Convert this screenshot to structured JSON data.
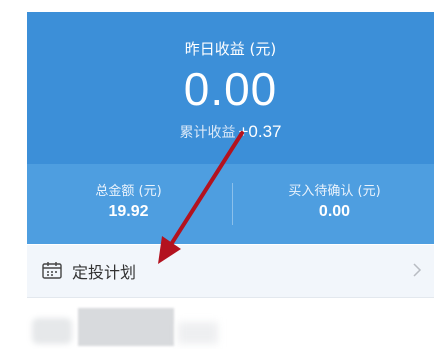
{
  "summary": {
    "yesterday_label": "昨日收益 (元)",
    "yesterday_value": "0.00",
    "cumulative_label": "累计收益",
    "cumulative_value": "+0.37"
  },
  "stats": {
    "total_label": "总金额 (元)",
    "total_value": "19.92",
    "pending_label": "买入待确认 (元)",
    "pending_value": "0.00"
  },
  "plan": {
    "label": "定投计划",
    "icon": "calendar-icon",
    "chevron": "chevron-right-icon"
  },
  "annotation": {
    "arrow_color": "#b3121f"
  },
  "colors": {
    "primary": "#3c8fd8",
    "primary_light": "#4e9ee0",
    "row_bg": "#f2f6fb"
  }
}
